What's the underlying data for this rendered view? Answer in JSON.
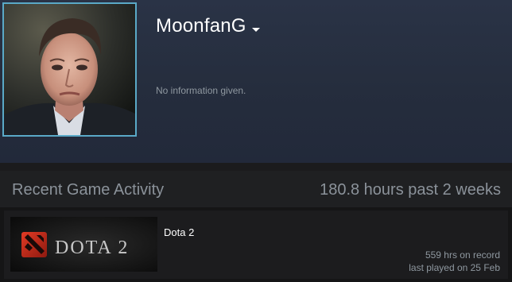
{
  "profile": {
    "persona_name": "MoonfanG",
    "summary": "No information given."
  },
  "recent_activity": {
    "title": "Recent Game Activity",
    "hours_summary": "180.8 hours past 2 weeks",
    "games": [
      {
        "name": "Dota 2",
        "logo_text": "DOTA 2",
        "hours_on_record": "559 hrs on record",
        "last_played": "last played on 25 Feb"
      }
    ]
  },
  "colors": {
    "header_background": "#252d3d",
    "avatar_border": "#5aa9c7",
    "page_background": "#1b1b1d",
    "muted_text": "#8f98a0",
    "dota_red": "#b8291a"
  },
  "icons": {
    "persona_menu": "chevron-down-icon",
    "game_logo": "dota-2-logo"
  }
}
